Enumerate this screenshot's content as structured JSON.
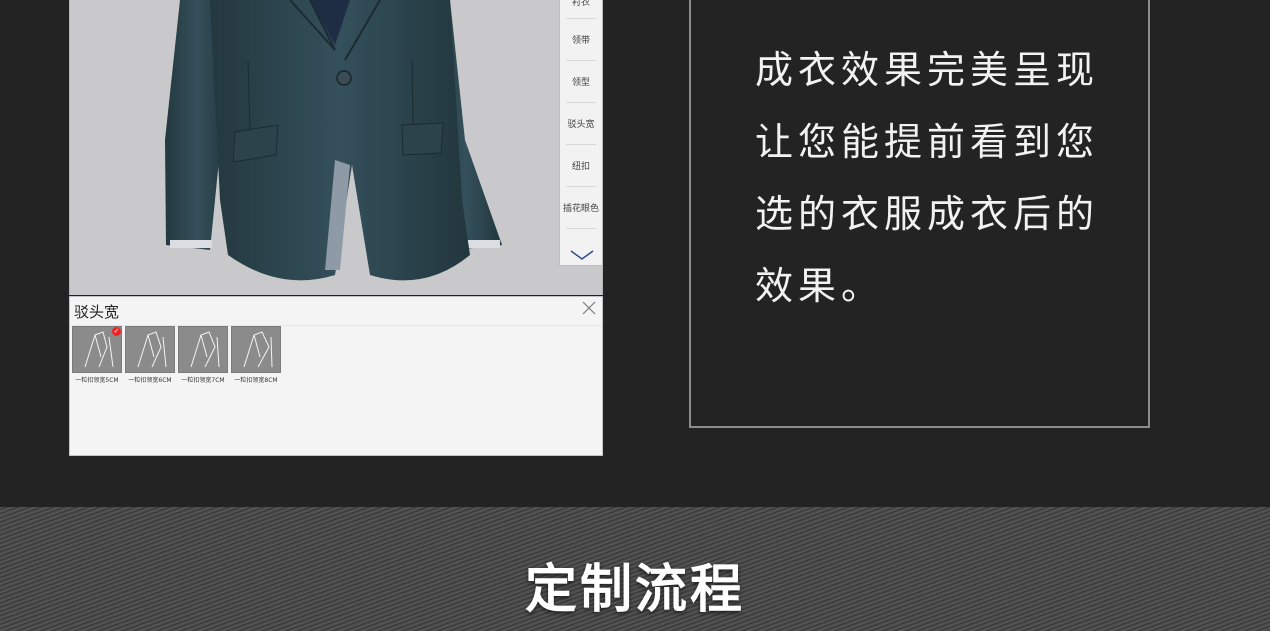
{
  "side_menu": {
    "items": [
      {
        "label": "衬衣"
      },
      {
        "label": "领带"
      },
      {
        "label": "领型"
      },
      {
        "label": "驳头宽"
      },
      {
        "label": "纽扣"
      },
      {
        "label": "插花眼色"
      }
    ],
    "scroll_icon": "chevron-down-icon"
  },
  "panel": {
    "title": "驳头宽",
    "close_icon": "close-icon",
    "options": [
      {
        "caption": "一粒扣领宽5CM",
        "selected": true
      },
      {
        "caption": "一粒扣领宽6CM",
        "selected": false
      },
      {
        "caption": "一粒扣领宽7CM",
        "selected": false
      },
      {
        "caption": "一粒扣领宽8CM",
        "selected": false
      }
    ],
    "check_icon": "check-icon"
  },
  "feature": {
    "lines": [
      "成衣效果完美呈现",
      "让您能提前看到您",
      "选的衣服成衣后的",
      "效果。"
    ]
  },
  "section": {
    "title": "定制流程"
  },
  "colors": {
    "background": "#232323",
    "suit": "#2d4650",
    "viewer_bg": "#c9c9cb",
    "accent_check": "#e22222"
  }
}
